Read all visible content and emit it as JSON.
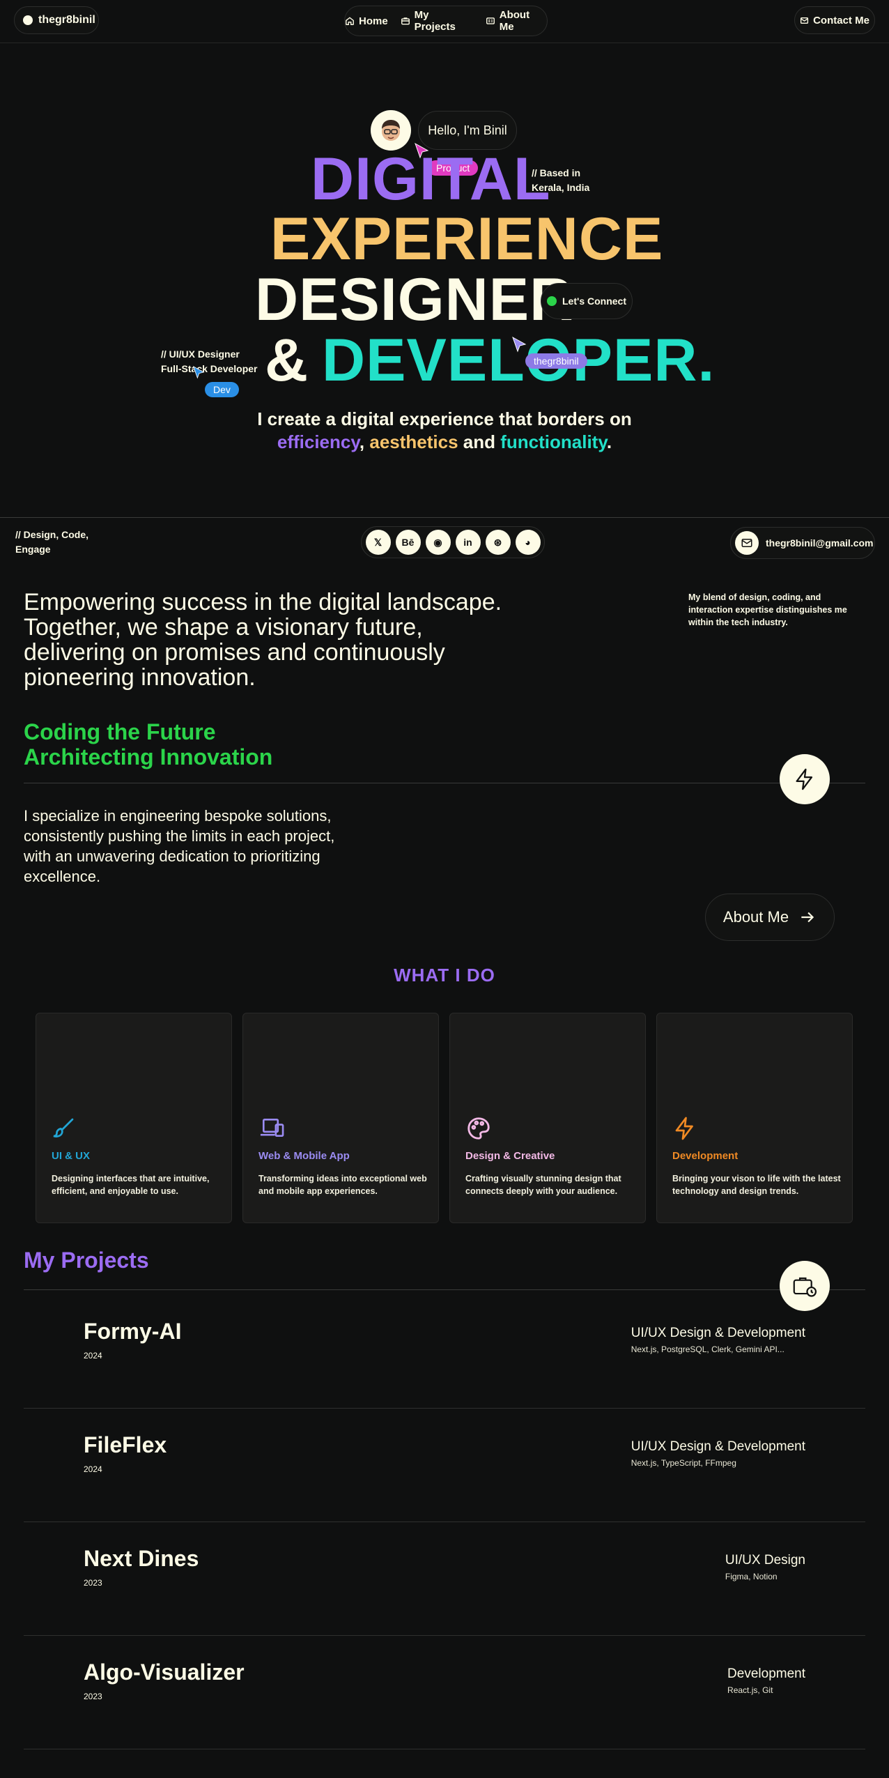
{
  "nav": {
    "brand": "thegr8binil",
    "links": [
      {
        "label": "Home",
        "icon": "home-icon"
      },
      {
        "label": "My Projects",
        "icon": "briefcase-icon"
      },
      {
        "label": "About Me",
        "icon": "id-card-icon"
      }
    ],
    "contact": "Contact Me"
  },
  "hero": {
    "greeting": "Hello, I'm Binil",
    "tag_product": "Product",
    "tag_dev": "Dev",
    "tag_user": "thegr8binil",
    "headline": {
      "line1": "DIGITAL",
      "line2": "EXPERIENCE",
      "line3": "DESIGNER",
      "line4_amp": "&",
      "line4": "DEVELOPER."
    },
    "location_note_1": "// Based in",
    "location_note_2": "Kerala, India",
    "role_note_1": "// UI/UX Designer",
    "role_note_2": "Full-Stack Developer",
    "connect": "Let's Connect",
    "lead_1": "I create a digital experience that borders on",
    "lead_efficiency": "efficiency",
    "lead_comma": ",",
    "lead_aesthetics": "aesthetics",
    "lead_and": "and",
    "lead_functionality": "functionality",
    "lead_period": "."
  },
  "social_row": {
    "note_1": "// Design, Code,",
    "note_2": "Engage",
    "icons": [
      {
        "name": "x-twitter-icon",
        "glyph": "𝕏"
      },
      {
        "name": "behance-icon",
        "glyph": "Bē"
      },
      {
        "name": "github-icon",
        "glyph": "◉"
      },
      {
        "name": "linkedin-icon",
        "glyph": "in"
      },
      {
        "name": "dribbble-icon",
        "glyph": "⊛"
      },
      {
        "name": "discord-icon",
        "glyph": "◕"
      }
    ],
    "email": "thegr8binil@gmail.com"
  },
  "intro": {
    "statement": "Empowering success in the digital landscape. Together, we shape a visionary future, delivering on promises and continuously pioneering innovation.",
    "side_note": "My blend of design, coding, and interaction expertise distinguishes me within the tech industry.",
    "green_1": "Coding the Future",
    "green_2": "Architecting Innovation",
    "specialize": "I specialize in engineering bespoke solutions, consistently pushing the limits in each project, with an unwavering dedication to prioritizing excellence.",
    "about_button": "About Me"
  },
  "services": {
    "heading": "WHAT I DO",
    "items": [
      {
        "title": "UI & UX",
        "desc": "Designing interfaces that are intuitive, efficient, and enjoyable to use.",
        "color": "#22a6d6",
        "icon": "brush-icon"
      },
      {
        "title": "Web & Mobile App",
        "desc": "Transforming ideas into exceptional web and mobile app experiences.",
        "color": "#9b8cf2",
        "icon": "devices-icon"
      },
      {
        "title": "Design & Creative",
        "desc": "Crafting visually stunning design that connects deeply with your audience.",
        "color": "#f3b9e6",
        "icon": "palette-icon"
      },
      {
        "title": "Development",
        "desc": "Bringing your vison to life with the latest technology and design trends.",
        "color": "#f08a24",
        "icon": "bolt-icon"
      }
    ]
  },
  "projects": {
    "heading": "My Projects",
    "items": [
      {
        "name": "Formy-AI",
        "year": "2024",
        "category": "UI/UX Design & Development",
        "tech": "Next.js, PostgreSQL, Clerk, Gemini API..."
      },
      {
        "name": "FileFlex",
        "year": "2024",
        "category": "UI/UX Design & Development",
        "tech": "Next.js, TypeScript, FFmpeg"
      },
      {
        "name": "Next Dines",
        "year": "2023",
        "category": "UI/UX Design",
        "tech": "Figma, Notion"
      },
      {
        "name": "Algo-Visualizer",
        "year": "2023",
        "category": "Development",
        "tech": "React.js, Git"
      }
    ]
  },
  "colors": {
    "background": "#0f1010",
    "cream": "#fdfbe6",
    "purple": "#9b6cf2",
    "yellow": "#f7c46c",
    "teal": "#22e0c8",
    "green": "#2bd44a",
    "pink": "#e03ac0",
    "blue": "#2a8fe6"
  }
}
